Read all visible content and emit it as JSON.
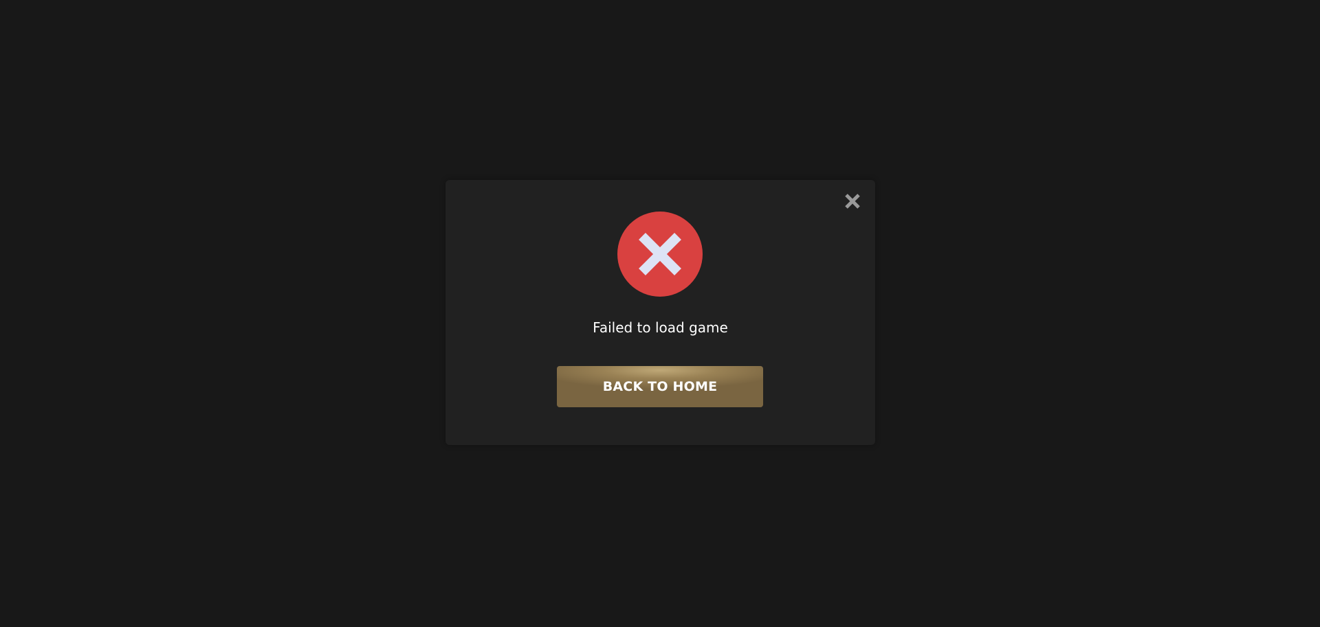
{
  "modal": {
    "message": "Failed to load game",
    "back_button_label": "BACK TO HOME",
    "close_icon": "close-icon",
    "error_icon": "error-x-icon"
  },
  "colors": {
    "background": "#181818",
    "modal_background": "#212121",
    "error_red": "#d94140",
    "icon_cross": "#dde3f5",
    "close_icon": "#9a9a9a",
    "button_gold": "#9a8255",
    "text": "#ffffff"
  }
}
